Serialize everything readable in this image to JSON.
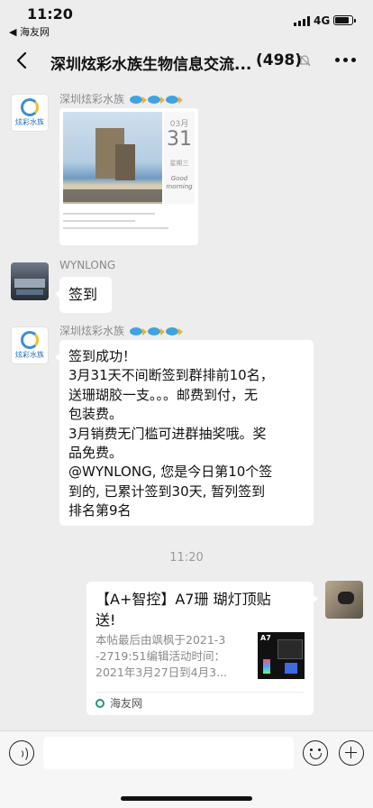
{
  "status_bar": {
    "time": "11:20",
    "back_app": "◀ 海友网",
    "network": "4G"
  },
  "nav": {
    "title": "深圳炫彩水族生物信息交流...",
    "member_count": "(498)"
  },
  "messages": [
    {
      "sender": "深圳炫彩水族",
      "avatar_text": "炫彩水族",
      "type": "image",
      "image": {
        "month": "03月",
        "day": "31",
        "weekday": "星期三",
        "greeting_lines": [
          "Good",
          "morning"
        ]
      }
    },
    {
      "sender": "WYNLONG",
      "type": "text",
      "lines": [
        "签到"
      ]
    },
    {
      "sender": "深圳炫彩水族",
      "avatar_text": "炫彩水族",
      "type": "text",
      "lines": [
        "签到成功！",
        "3月31天不间断签到群排前10名，",
        "送珊瑚胶一支。。。邮费到付，无",
        "包装费。",
        "3月销费无门槛可进群抽奖哦。奖",
        "品免费。",
        "@WYNLONG, 您是今日第10个签",
        "到的, 已累计签到30天, 暂列签到",
        "排名第9名"
      ]
    }
  ],
  "timestamp": "11:20",
  "link_card": {
    "title_lines": [
      "【A+智控】A7珊 瑚灯顶贴",
      "送!"
    ],
    "desc_lines": [
      "本帖最后由飒枫于2021-3",
      "-2719:51编辑活动时间：",
      "2021年3月27日到4月3..."
    ],
    "thumb_label": "A7",
    "source": "海友网"
  }
}
